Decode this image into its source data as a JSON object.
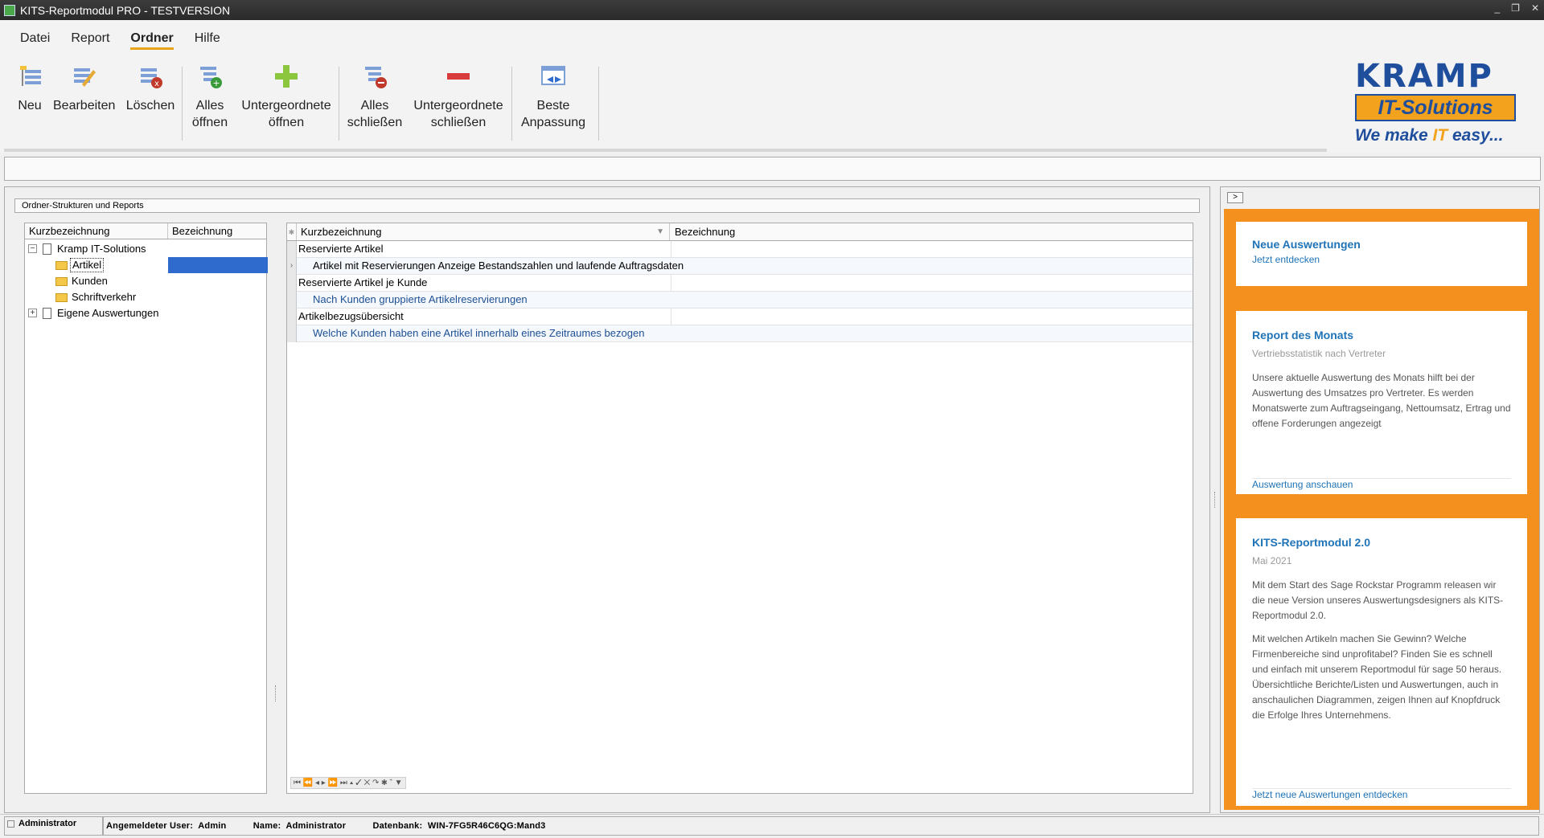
{
  "window": {
    "title": "KITS-Reportmodul PRO - TESTVERSION",
    "controls": [
      "_",
      "❐",
      "✕"
    ]
  },
  "menu": [
    "Datei",
    "Report",
    "Ordner",
    "Hilfe"
  ],
  "toolbar": {
    "new": "Neu",
    "edit": "Bearbeiten",
    "delete": "Löschen",
    "open_all_1": "Alles",
    "open_all_2": "öffnen",
    "open_sub_1": "Untergeordnete",
    "open_sub_2": "öffnen",
    "close_all_1": "Alles",
    "close_all_2": "schließen",
    "close_sub_1": "Untergeordnete",
    "close_sub_2": "schließen",
    "fit_1": "Beste",
    "fit_2": "Anpassung"
  },
  "logo": {
    "name": "KRAMP",
    "sub": "IT-Solutions",
    "slogan_a": "We make ",
    "slogan_b": "IT",
    "slogan_c": " easy..."
  },
  "group_title": "Ordner-Strukturen und Reports",
  "tree": {
    "col1": "Kurzbezeichnung",
    "col2": "Bezeichnung",
    "root": "Kramp IT-Solutions",
    "items": [
      "Artikel",
      "Kunden",
      "Schriftverkehr"
    ],
    "own": "Eigene Auswertungen"
  },
  "reports": {
    "col1": "Kurzbezeichnung",
    "col2": "Bezeichnung",
    "rows": [
      {
        "title": "Reservierte Artikel",
        "desc": "Artikel mit Reservierungen Anzeige Bestandszahlen und laufende Auftragsdaten"
      },
      {
        "title": "Reservierte Artikel je Kunde",
        "desc": "Nach Kunden gruppierte Artikelreservierungen"
      },
      {
        "title": "Artikelbezugsübersicht",
        "desc": "Welche Kunden haben eine Artikel innerhalb eines Zeitraumes bezogen"
      }
    ],
    "nav": "⏮ ⏪ ◂ ▸ ⏩ ⏭ ▴ ✓ ✕ ↷ ✱ ⁺ ▼"
  },
  "side": {
    "collapse": ">",
    "card1": {
      "title": "Neue Auswertungen",
      "sub": "Jetzt entdecken"
    },
    "card2": {
      "title": "Report des Monats",
      "sub": "Vertriebsstatistik nach Vertreter",
      "body": "Unsere aktuelle Auswertung des Monats hilft bei der Auswertung des Umsatzes pro Vertreter. Es werden Monatswerte zum Auftragseingang, Nettoumsatz, Ertrag und offene Forderungen angezeigt",
      "link": "Auswertung anschauen"
    },
    "card3": {
      "title": "KITS-Reportmodul 2.0",
      "sub": "Mai 2021",
      "body1": "Mit dem Start des Sage Rockstar Programm releasen wir die neue Version unseres Auswertungsdesigners als KITS-Reportmodul 2.0.",
      "body2": "Mit welchen Artikeln machen Sie Gewinn? Welche Firmenbereiche sind unprofitabel? Finden Sie es schnell und einfach mit unserem Reportmodul für sage 50 heraus. Übersichtliche Berichte/Listen und Auswertungen, auch in anschaulichen Diagrammen, zeigen Ihnen auf Knopfdruck die Erfolge Ihres Unternehmens.",
      "link": "Jetzt neue Auswertungen entdecken"
    }
  },
  "status": {
    "user_box": "Administrator",
    "user_label": "Angemeldeter User:",
    "user_value": "Admin",
    "name_label": "Name:",
    "name_value": "Administrator",
    "db_label": "Datenbank:",
    "db_value": "WIN-7FG5R46C6QG:Mand3"
  }
}
